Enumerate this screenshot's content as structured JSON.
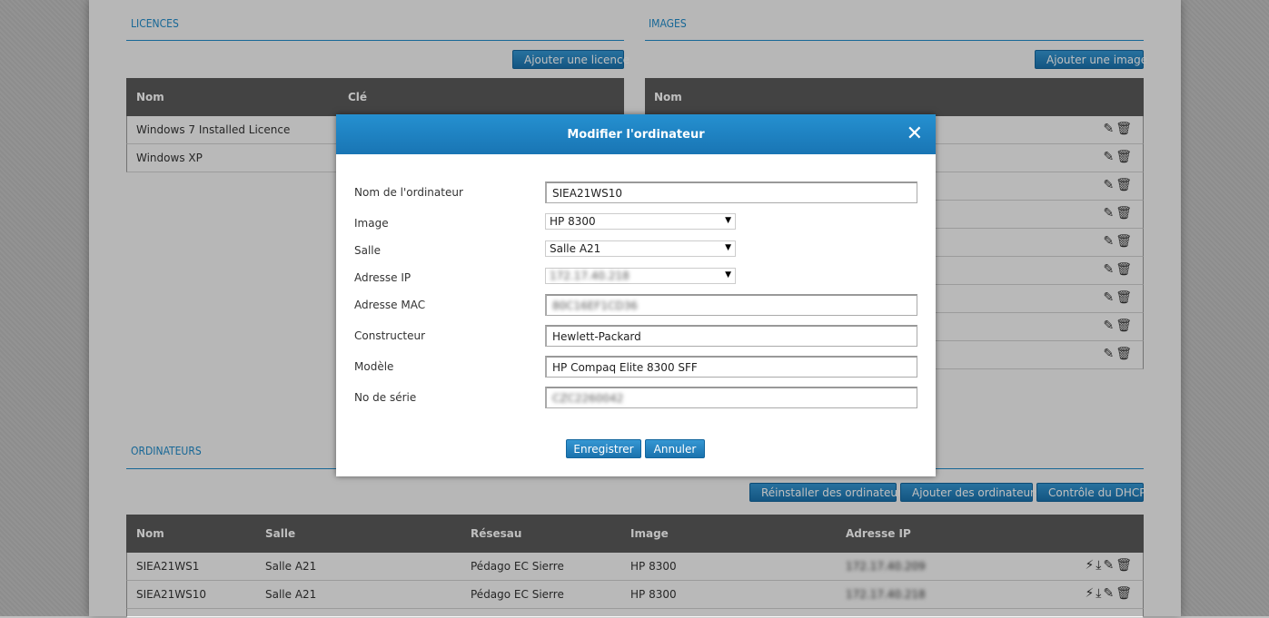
{
  "licences": {
    "title": "LICENCES",
    "add_button": "Ajouter une licence",
    "columns": [
      "Nom",
      "Clé"
    ],
    "rows": [
      {
        "name": "Windows 7 Installed Licence"
      },
      {
        "name": "Windows XP"
      }
    ]
  },
  "images": {
    "title": "IMAGES",
    "add_button": "Ajouter une image",
    "columns": [
      "Nom"
    ],
    "row_count": 9
  },
  "ordinateurs": {
    "title": "ORDINATEURS",
    "buttons": {
      "reinstall": "Réinstaller des ordinateurs",
      "add": "Ajouter des ordinateurs",
      "dhcp": "Contrôle du DHCP"
    },
    "columns": [
      "Nom",
      "Salle",
      "Résesau",
      "Image",
      "Adresse IP"
    ],
    "rows": [
      {
        "name": "SIEA21WS1",
        "salle": "Salle A21",
        "reseau": "Pédago EC Sierre",
        "image": "HP 8300",
        "ip": "172.17.40.209"
      },
      {
        "name": "SIEA21WS10",
        "salle": "Salle A21",
        "reseau": "Pédago EC Sierre",
        "image": "HP 8300",
        "ip": "172.17.40.218"
      }
    ]
  },
  "modal": {
    "title": "Modifier l'ordinateur",
    "close_icon": "close-icon",
    "fields": {
      "nom_label": "Nom de l'ordinateur",
      "nom_value": "SIEA21WS10",
      "image_label": "Image",
      "image_value": "HP 8300",
      "salle_label": "Salle",
      "salle_value": "Salle A21",
      "ip_label": "Adresse IP",
      "ip_value": "172.17.40.218",
      "mac_label": "Adresse MAC",
      "mac_value": "80C16EF1CD36",
      "constructeur_label": "Constructeur",
      "constructeur_value": "Hewlett-Packard",
      "modele_label": "Modèle",
      "modele_value": "HP Compaq Elite 8300 SFF",
      "serie_label": "No de série",
      "serie_value": "CZC2260042"
    },
    "save_button": "Enregistrer",
    "cancel_button": "Annuler"
  },
  "colors": {
    "accent": "#1f8ac8",
    "table_header": "#5a5a5a"
  }
}
